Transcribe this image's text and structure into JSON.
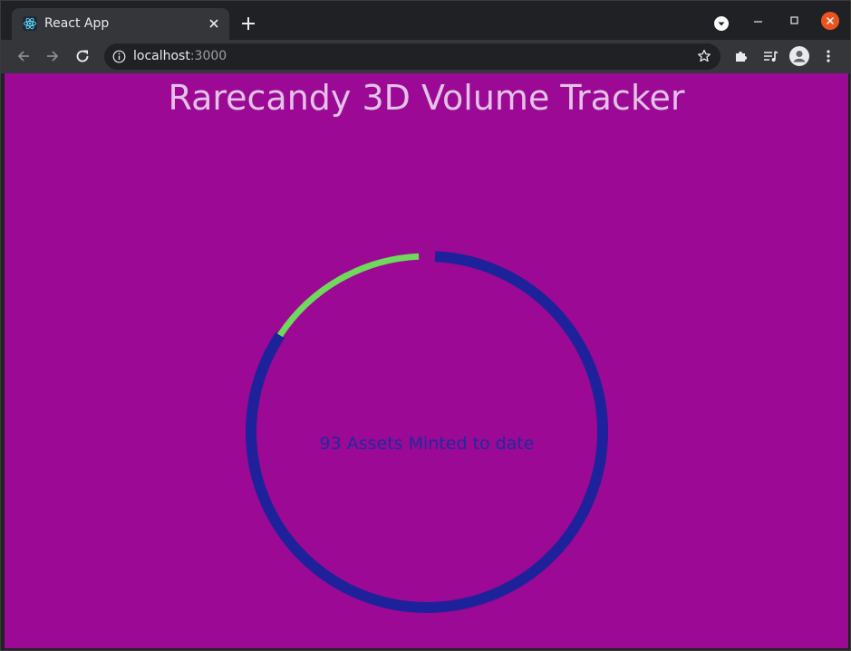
{
  "browser": {
    "tab_title": "React App",
    "tab_close_icon": "close-icon",
    "new_tab_icon": "plus-icon",
    "url_host": "localhost",
    "url_port": ":3000",
    "colors": {
      "frame": "#202124",
      "toolbar": "#35363a",
      "text": "#e8eaed",
      "close_button": "#e95420"
    }
  },
  "page": {
    "title": "Rarecandy 3D Volume Tracker",
    "background": "#9c0994",
    "title_color": "#e3c2e8"
  },
  "gauge": {
    "label": "93 Assets Minted to date",
    "progress_fraction": 0.15,
    "track_color": "#1d229a",
    "progress_color": "#6ed95b",
    "label_color": "#1f2a9e"
  }
}
